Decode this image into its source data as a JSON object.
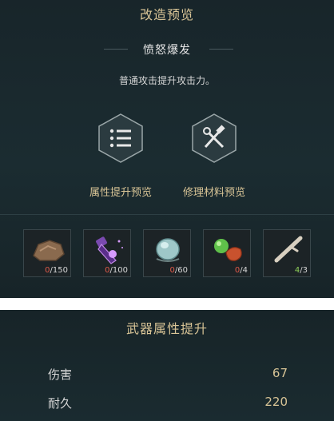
{
  "header": {
    "title": "改造预览"
  },
  "skill": {
    "name": "愤怒爆发",
    "description": "普通攻击提升攻击力。"
  },
  "options": [
    {
      "label": "属性提升预览",
      "icon": "list-icon"
    },
    {
      "label": "修理材料预览",
      "icon": "repair-tools-icon"
    }
  ],
  "materials": [
    {
      "icon": "ore-chunk-icon",
      "have": "0",
      "need": "/150",
      "enough": false
    },
    {
      "icon": "purple-crystal-bottle-icon",
      "have": "0",
      "need": "/100",
      "enough": false
    },
    {
      "icon": "blue-gem-pouch-icon",
      "have": "0",
      "need": "/60",
      "enough": false
    },
    {
      "icon": "green-orb-meat-icon",
      "have": "0",
      "need": "/4",
      "enough": false
    },
    {
      "icon": "bone-stick-icon",
      "have": "4",
      "need": "/3",
      "enough": true
    }
  ],
  "weapon_stats": {
    "title": "武器属性提升",
    "rows": [
      {
        "name": "伤害",
        "value": "67"
      },
      {
        "name": "耐久",
        "value": "220"
      }
    ]
  },
  "colors": {
    "gold": "#d8c496",
    "red": "#e05a4a",
    "green": "#8fcf5a",
    "panel": "#1b2c31"
  }
}
